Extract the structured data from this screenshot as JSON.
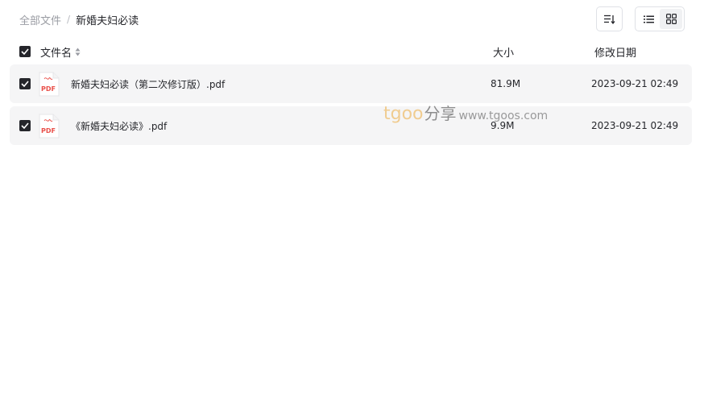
{
  "breadcrumb": {
    "root": "全部文件",
    "separator": "/",
    "current": "新婚夫妇必读"
  },
  "toolbar": {
    "sort_icon": "sort-list-icon",
    "list_view_icon": "list-view-icon",
    "grid_view_icon": "grid-view-icon",
    "active_view": "list"
  },
  "table": {
    "headers": {
      "name": "文件名",
      "size": "大小",
      "date": "修改日期"
    },
    "rows": [
      {
        "name": "新婚夫妇必读（第二次修订版）.pdf",
        "size": "81.9M",
        "date": "2023-09-21 02:49",
        "icon": "pdf-file-icon",
        "checked": true
      },
      {
        "name": "《新婚夫妇必读》.pdf",
        "size": "9.9M",
        "date": "2023-09-21 02:49",
        "icon": "pdf-file-icon",
        "checked": true
      }
    ]
  },
  "watermark": {
    "logo": "tgoo",
    "cn": "分享",
    "url": "www.tgoos.com"
  },
  "colors": {
    "text": "#25262b",
    "muted": "#9a9ca3",
    "row_bg": "#f5f5f6",
    "pdf_red": "#e9504a",
    "watermark_orange": "#f0c57f"
  }
}
